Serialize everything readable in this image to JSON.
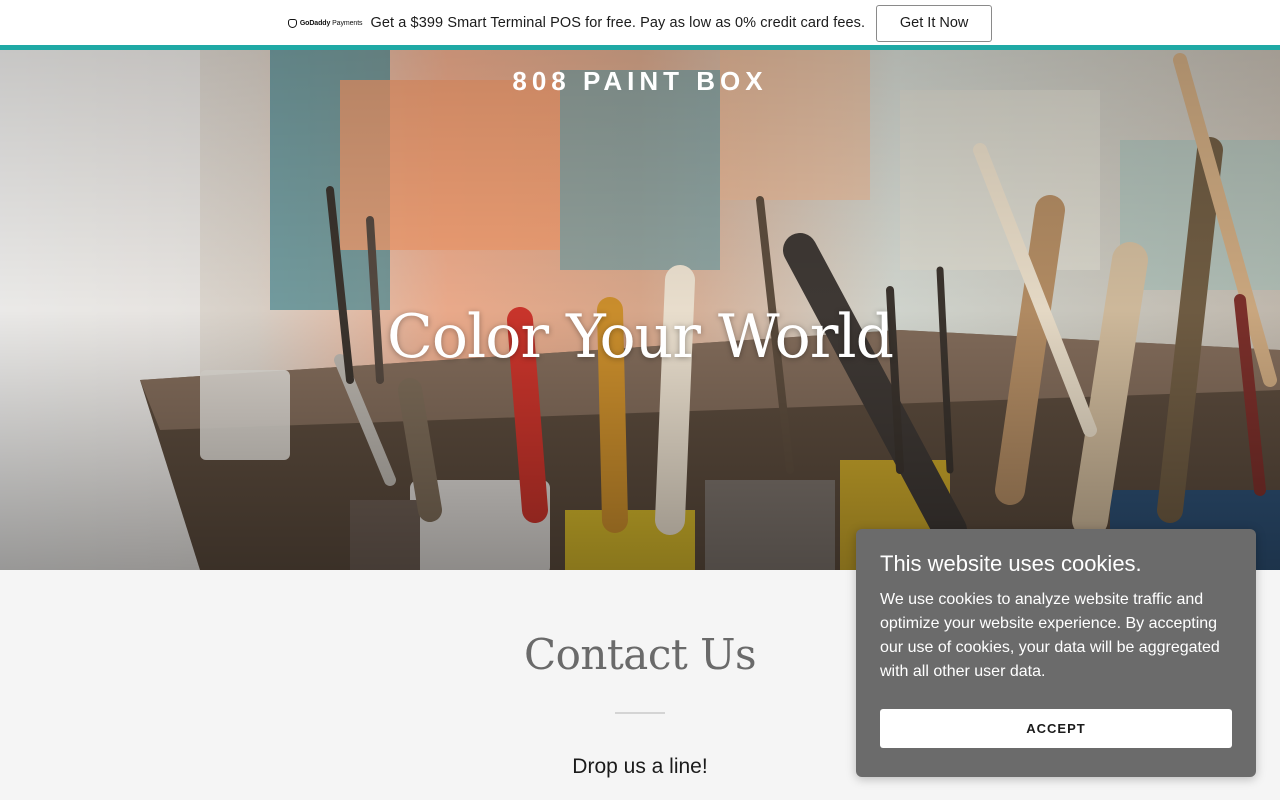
{
  "promo": {
    "logo_brand": "GoDaddy",
    "logo_product": "Payments",
    "message": "Get a $399 Smart Terminal POS for free. Pay as low as 0% credit card fees.",
    "button_label": "Get It Now",
    "accent_color": "#1fa9a5"
  },
  "hero": {
    "site_title": "808 PAINT BOX",
    "heading": "Color Your World"
  },
  "contact": {
    "title": "Contact Us",
    "subtitle": "Drop us a line!"
  },
  "cookie_banner": {
    "title": "This website uses cookies.",
    "body": "We use cookies to analyze website traffic and optimize your website experience. By accepting our use of cookies, your data will be aggregated with all other user data.",
    "accept_label": "ACCEPT",
    "background_color": "#6b6b6b"
  }
}
